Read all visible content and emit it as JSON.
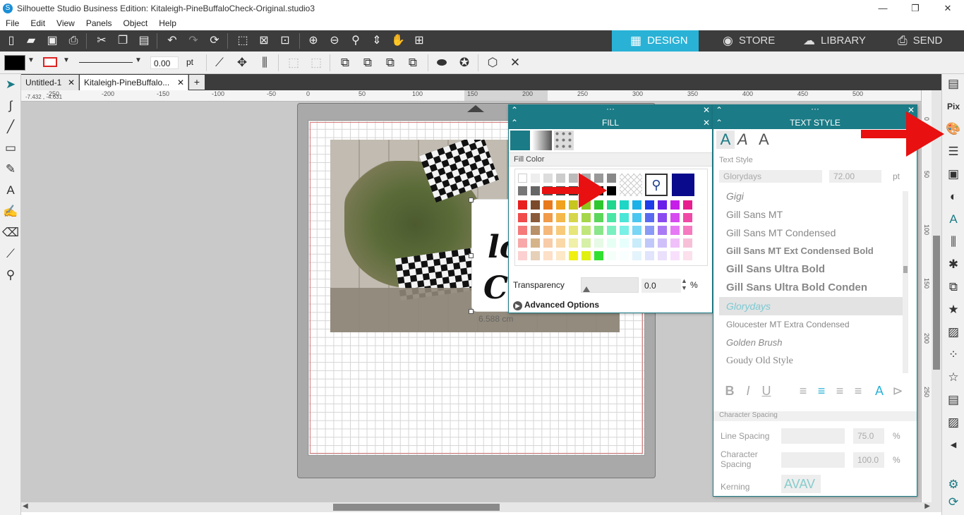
{
  "window": {
    "title": "Silhouette Studio Business Edition: Kitaleigh-PineBuffaloCheck-Original.studio3",
    "minimize": "—",
    "restore": "❐",
    "close": "✕"
  },
  "menu": [
    "File",
    "Edit",
    "View",
    "Panels",
    "Object",
    "Help"
  ],
  "modes": [
    {
      "label": "DESIGN",
      "icon": "grid-icon",
      "active": true
    },
    {
      "label": "STORE",
      "icon": "store-icon",
      "active": false
    },
    {
      "label": "LIBRARY",
      "icon": "cloud-icon",
      "active": false
    },
    {
      "label": "SEND",
      "icon": "send-icon",
      "active": false
    }
  ],
  "toolbar2": {
    "line_width": "0.00",
    "unit": "pt"
  },
  "tabs": [
    {
      "label": "Untitled-1",
      "close": "✕"
    },
    {
      "label": "Kitaleigh-PineBuffalo...",
      "close": "✕"
    }
  ],
  "add_tab": "+",
  "ruler": {
    "coords": "-7.432 , -4.631",
    "h_ticks": [
      "-250",
      "-200",
      "-150",
      "-100",
      "-50",
      "0",
      "50",
      "100",
      "150",
      "200",
      "250",
      "300",
      "350",
      "400",
      "450",
      "500"
    ],
    "v_ticks": [
      "0",
      "50",
      "100",
      "150",
      "200",
      "250"
    ]
  },
  "canvas": {
    "dimension_label": "6.588 cm",
    "sign_text": [
      "~",
      "lo",
      "Co"
    ]
  },
  "fill_panel": {
    "title": "FILL",
    "dots": "···",
    "section": "Fill Color",
    "transparency_label": "Transparency",
    "transparency_value": "0.0",
    "transparency_unit": "%",
    "advanced": "Advanced Options",
    "accent_color": "#1b7b86",
    "swatch_rows": [
      [
        "#ffffff",
        "#eeeeee",
        "#dddddd",
        "#cccccc",
        "#bbbbbb",
        "#aaaaaa",
        "#999999",
        "#888888"
      ],
      [
        "#777777",
        "#666666",
        "#555555",
        "#444444",
        "#333333",
        "#222222",
        "#111111",
        "#000000"
      ],
      [
        "#e81e1e",
        "#7a4a2a",
        "#e87a1e",
        "#f0a21e",
        "#c6c61e",
        "#8ec61e",
        "#2ec62e",
        "#1ed68e",
        "#1ed6c6",
        "#1eb0e8",
        "#1e3ce8",
        "#6a1ee8",
        "#c61ee8",
        "#e81e8e"
      ],
      [
        "#f04a4a",
        "#8a5a3a",
        "#f09a4a",
        "#f5b84a",
        "#d6d64a",
        "#a6d64a",
        "#5ad65a",
        "#4ae6a6",
        "#4ae6d6",
        "#4ac6f0",
        "#5a6af0",
        "#8a4af0",
        "#d64af0",
        "#f04aa6"
      ],
      [
        "#f57a7a",
        "#b8906a",
        "#f5b87a",
        "#f8ca7a",
        "#e6e67a",
        "#c0e67a",
        "#8ae68a",
        "#7af0c0",
        "#7af0e6",
        "#7ad6f5",
        "#8a9af5",
        "#aa7af5",
        "#e67af5",
        "#f57ac0"
      ],
      [
        "#f8a8a8",
        "#d6b48a",
        "#f8cca8",
        "#fad8a8",
        "#f0f0a8",
        "#d6f0a8",
        "#e6fae6",
        "#e6fff4",
        "#e6fffc",
        "#c8ecfa",
        "#c0c8fa",
        "#d0c0fa",
        "#f0c0fa",
        "#f8c0d8"
      ],
      [
        "#fcd0d0",
        "#e6d0b8",
        "#fce0c8",
        "#fde8c8",
        "#f0f010",
        "#e0f010",
        "#30e030",
        "#f4fffa",
        "#f8fffe",
        "#e4f4fc",
        "#e0e4fc",
        "#eae0fc",
        "#f8e0fc",
        "#fce0ec"
      ]
    ]
  },
  "text_panel": {
    "title": "TEXT STYLE",
    "dots": "···",
    "section": "Text Style",
    "font": "Glorydays",
    "size": "72.00",
    "size_unit": "pt",
    "fonts": [
      "Gigi",
      "Gill Sans MT",
      "Gill Sans MT Condensed",
      "Gill Sans MT Ext Condensed Bold",
      "Gill Sans Ultra Bold",
      "Gill Sans Ultra Bold Conden",
      "Glorydays",
      "Gloucester MT Extra Condensed",
      "Golden Brush",
      "Goudy Old Style"
    ],
    "selected_font": "Glorydays",
    "char_spacing_section": "Character Spacing",
    "line_spacing_label": "Line Spacing",
    "line_spacing": "75.0",
    "char_spacing_label": "Character Spacing",
    "char_spacing": "100.0",
    "kerning_label": "Kerning",
    "pct": "%",
    "format_buttons": [
      "B",
      "I",
      "U"
    ]
  }
}
